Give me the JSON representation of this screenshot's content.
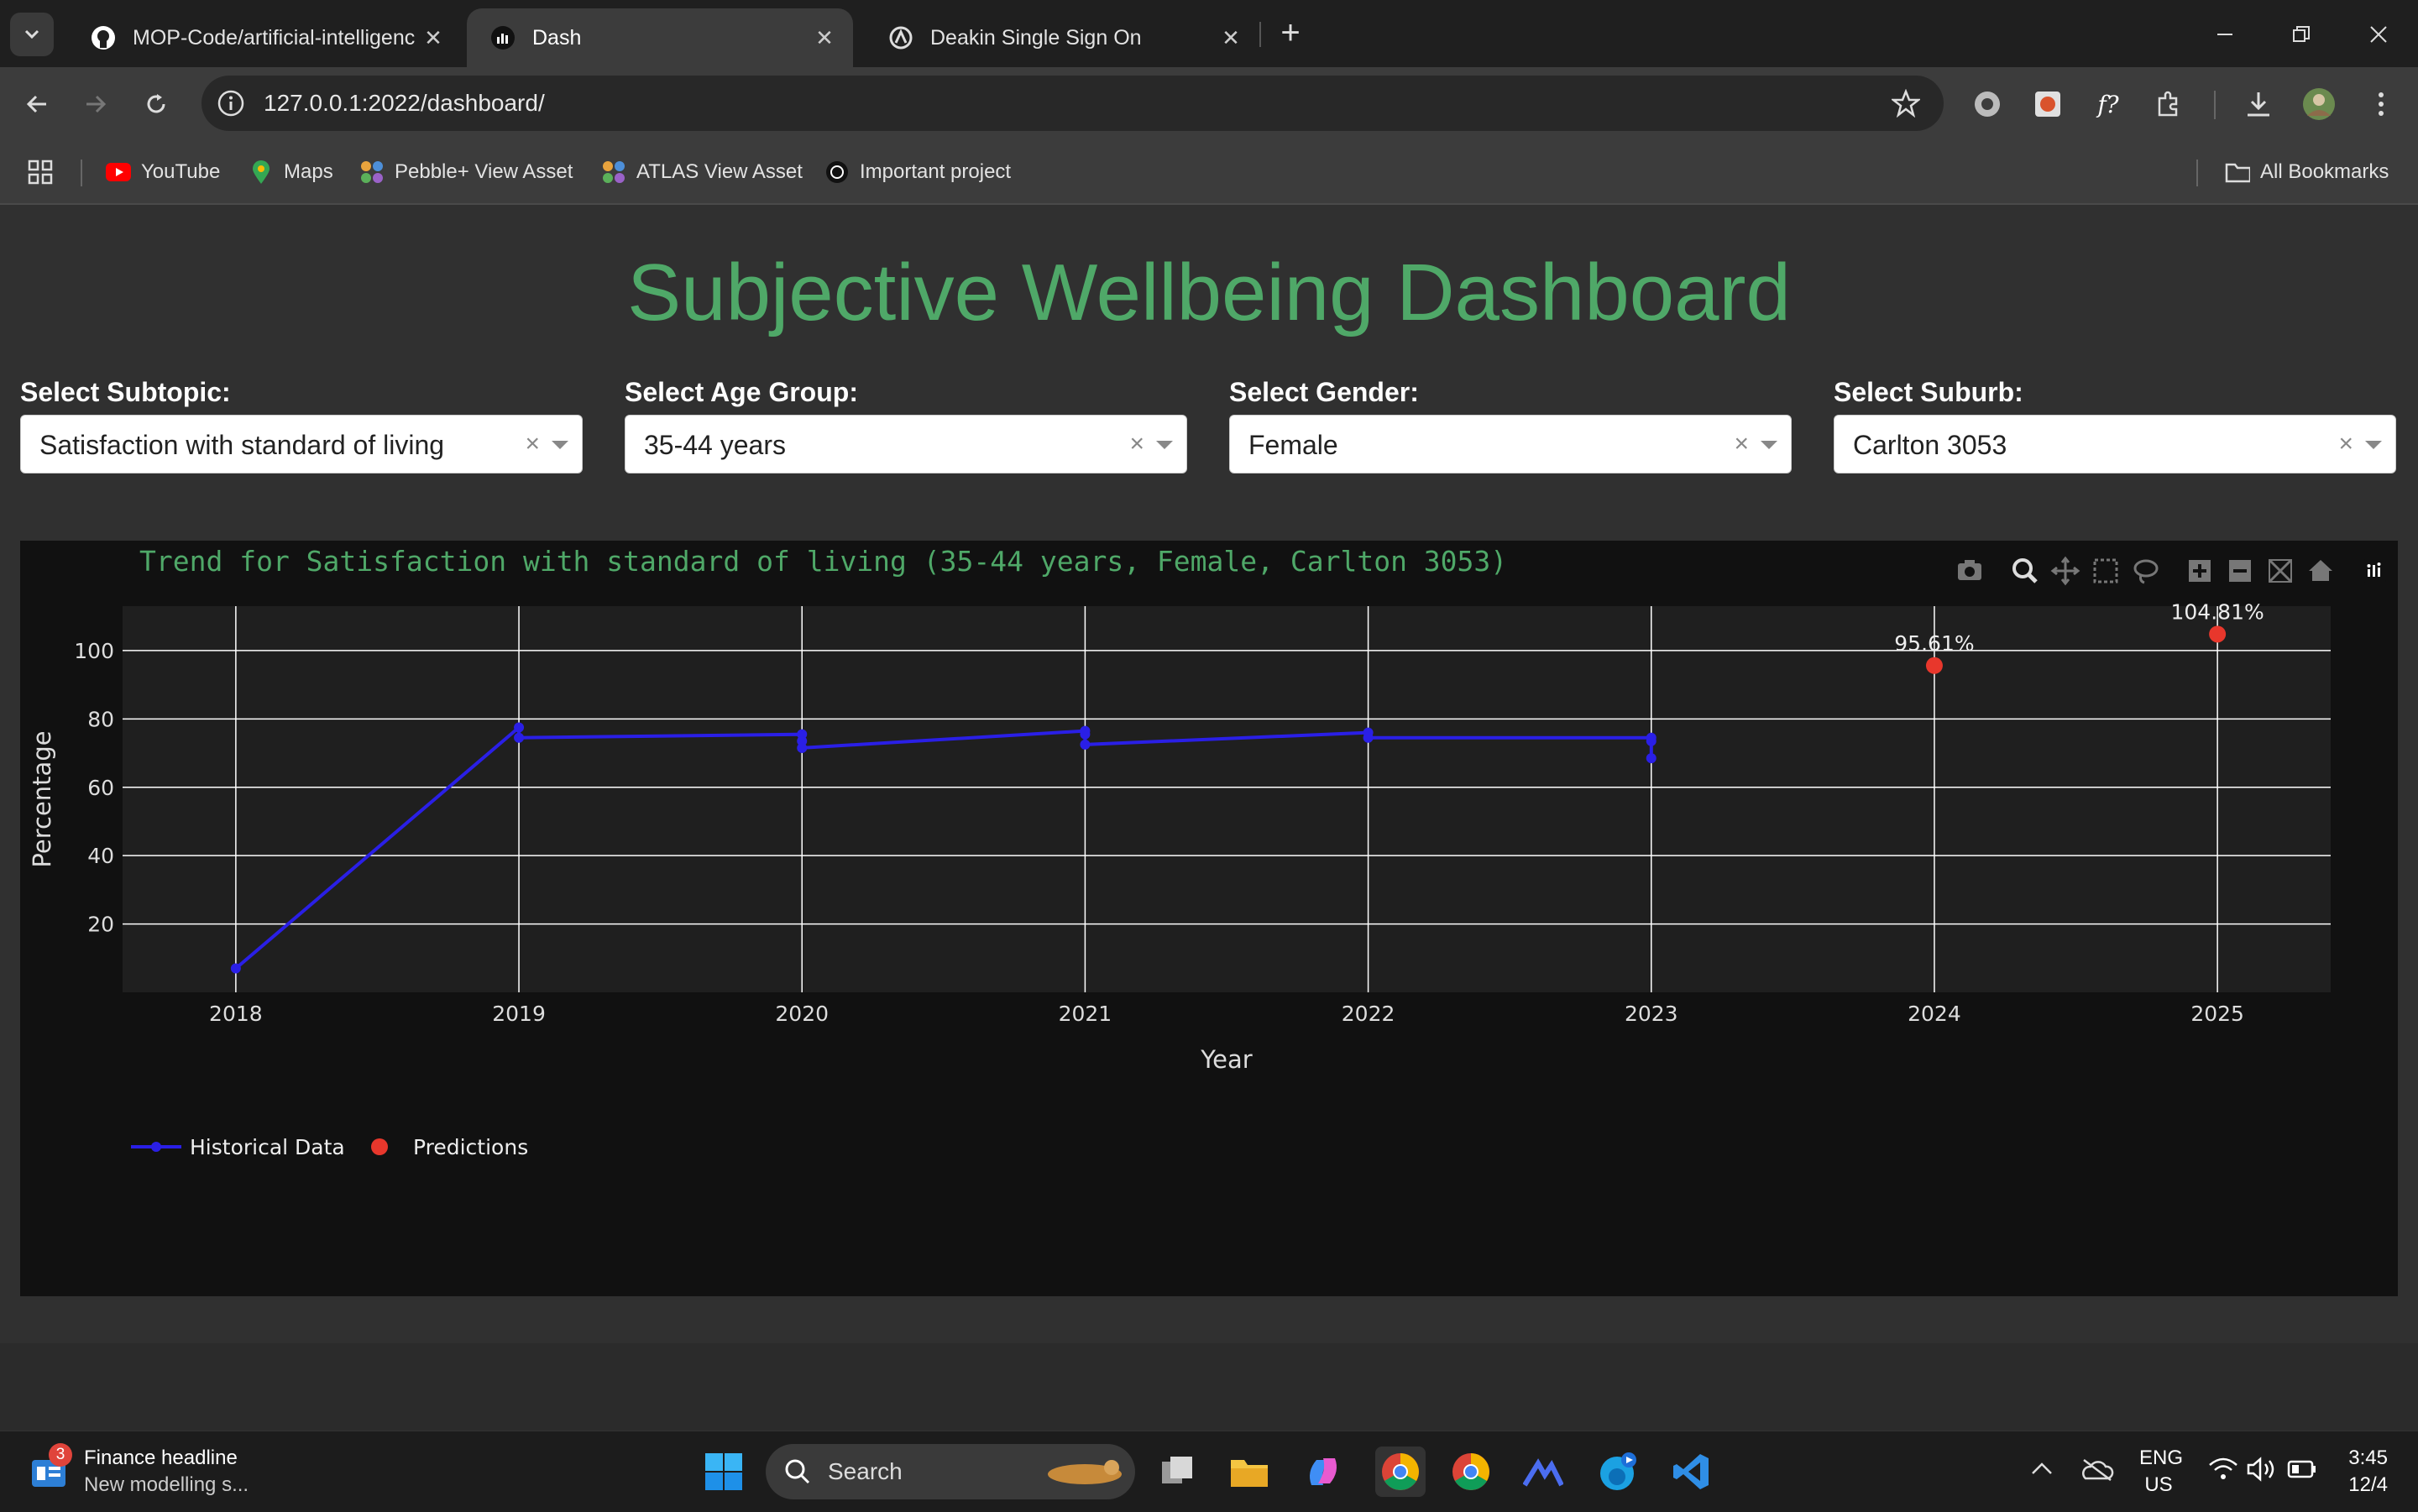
{
  "browser": {
    "tabs": [
      {
        "title": "MOP-Code/artificial-intelligenc",
        "icon": "github-icon"
      },
      {
        "title": "Dash",
        "icon": "dash-icon",
        "active": true
      },
      {
        "title": "Deakin Single Sign On",
        "icon": "sso-icon"
      }
    ],
    "new_tab": "+",
    "url": "127.0.0.1:2022/dashboard/",
    "bookmarks": [
      "YouTube",
      "Maps",
      "Pebble+ View Asset",
      "ATLAS View Asset",
      "Important project"
    ],
    "all_bookmarks": "All Bookmarks"
  },
  "page": {
    "title": "Subjective Wellbeing Dashboard",
    "filters": [
      {
        "label": "Select Subtopic:",
        "value": "Satisfaction with standard of living"
      },
      {
        "label": "Select Age Group:",
        "value": "35-44 years"
      },
      {
        "label": "Select Gender:",
        "value": "Female"
      },
      {
        "label": "Select Suburb:",
        "value": "Carlton 3053"
      }
    ]
  },
  "chart_data": {
    "type": "line",
    "title": "Trend for Satisfaction with standard of living (35-44 years, Female, Carlton 3053)",
    "xlabel": "Year",
    "ylabel": "Percentage",
    "xlim": [
      2017.6,
      2025.4
    ],
    "ylim": [
      0,
      113
    ],
    "x_ticks": [
      2018,
      2019,
      2020,
      2021,
      2022,
      2023,
      2024,
      2025
    ],
    "y_ticks": [
      20,
      40,
      60,
      80,
      100
    ],
    "grid": true,
    "legend_position": "bottom-left",
    "series": [
      {
        "name": "Historical Data",
        "type": "line",
        "color": "#2a1fe6",
        "points": [
          [
            2018,
            7
          ],
          [
            2019,
            77.5
          ],
          [
            2019,
            74.5
          ],
          [
            2020,
            75.5
          ],
          [
            2020,
            73.5
          ],
          [
            2020,
            71.5
          ],
          [
            2021,
            76.5
          ],
          [
            2021,
            75.5
          ],
          [
            2021,
            72.5
          ],
          [
            2022,
            76
          ],
          [
            2022,
            74.5
          ],
          [
            2023,
            74.5
          ],
          [
            2023,
            73.5
          ],
          [
            2023,
            68.5
          ]
        ]
      },
      {
        "name": "Predictions",
        "type": "scatter",
        "color": "#e8372c",
        "points": [
          [
            2024,
            95.61
          ],
          [
            2025,
            104.81
          ]
        ],
        "labels": [
          "95.61%",
          "104.81%"
        ]
      }
    ]
  },
  "taskbar": {
    "news_title": "Finance headline",
    "news_sub": "New modelling s...",
    "news_badge": "3",
    "search": "Search",
    "lang_top": "ENG",
    "lang_bottom": "US",
    "time": "3:45",
    "date": "12/4"
  }
}
